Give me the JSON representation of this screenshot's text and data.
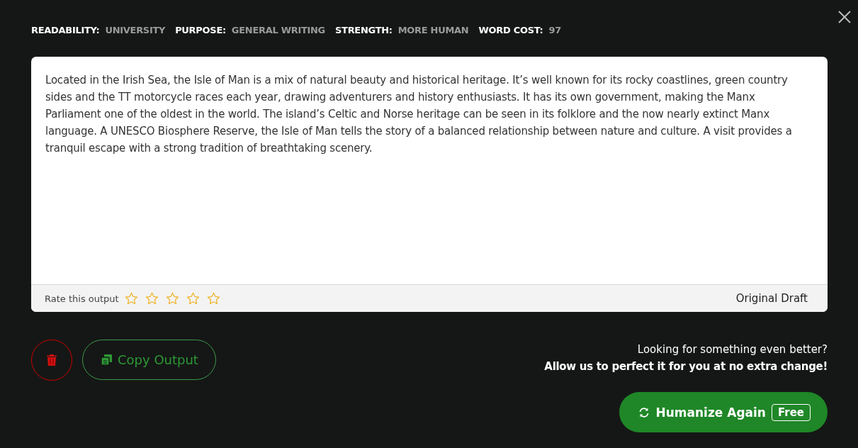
{
  "meta": [
    {
      "label": "READABILITY:",
      "value": "UNIVERSITY"
    },
    {
      "label": "PURPOSE:",
      "value": "GENERAL WRITING"
    },
    {
      "label": "STRENGTH:",
      "value": "MORE HUMAN"
    },
    {
      "label": "WORD COST:",
      "value": "97"
    }
  ],
  "output": {
    "text": "Located in the Irish Sea, the Isle of Man is a mix of natural beauty and historical heritage. It’s well known for its rocky coastlines, green country sides and the TT motorcycle races each year, drawing adventurers and history enthusiasts. It has its own government, making the Manx Parliament one of the oldest in the world. The island’s Celtic and Norse heritage can be seen in its folklore and the now nearly extinct Manx language. A UNESCO Biosphere Reserve, the Isle of Man tells the story of a balanced relationship between nature and culture. A visit provides a tranquil escape with a strong tradition of breathtaking scenery.",
    "rate_label": "Rate this output",
    "stars": 0,
    "draft_label": "Original Draft"
  },
  "copy_button": "Copy Output",
  "promo": {
    "line1": "Looking for something even better?",
    "line2": "Allow us to perfect it for you at no extra change!"
  },
  "humanize_button": {
    "label": "Humanize Again",
    "badge": "Free"
  }
}
